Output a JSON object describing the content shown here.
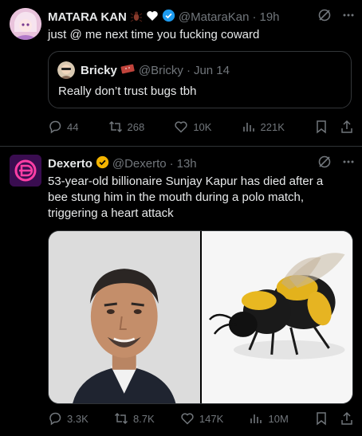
{
  "tweets": [
    {
      "author": {
        "name": "MATARA KAN",
        "handle": "@MataraKan",
        "time": "19h"
      },
      "text": "just @ me next time you fucking coward",
      "quote": {
        "author": {
          "name": "Bricky",
          "handle": "@Bricky",
          "date": "Jun 14"
        },
        "text": "Really don’t trust bugs tbh"
      },
      "stats": {
        "replies": "44",
        "reposts": "268",
        "likes": "10K",
        "views": "221K"
      }
    },
    {
      "author": {
        "name": "Dexerto",
        "handle": "@Dexerto",
        "time": "13h"
      },
      "text": "53-year-old billionaire Sunjay Kapur has died after a bee stung him in the mouth during a polo match, triggering a heart attack",
      "stats": {
        "replies": "3.3K",
        "reposts": "8.7K",
        "likes": "147K",
        "views": "10M"
      }
    }
  ],
  "separator": "·",
  "colors": {
    "background": "#000000",
    "text": "#e7e9ea",
    "muted": "#71767b",
    "verified": "#1d9bf0",
    "gold_check": "#f4b400",
    "border": "#2f3336"
  }
}
